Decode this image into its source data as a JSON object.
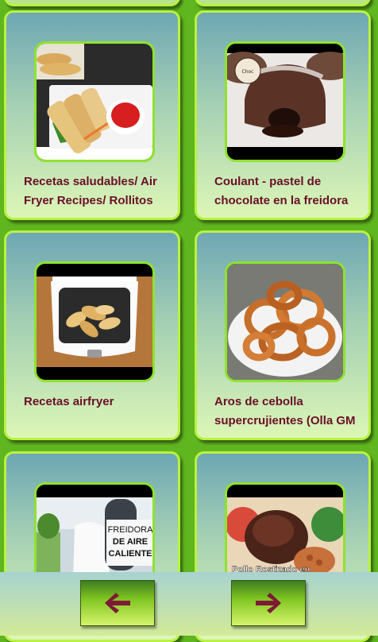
{
  "recipes": [
    {
      "title_line1": "Recetas saludables/ Air",
      "title_line2": "Fryer Recipes/ Rollitos",
      "image": "spring-rolls-photo"
    },
    {
      "title_line1": "Coulant - pastel de",
      "title_line2": "chocolate en la freidora",
      "image": "chocolate-lava-cake-photo"
    },
    {
      "title_line1": "Recetas airfryer",
      "title_line2": "",
      "image": "airfryer-potatoes-photo"
    },
    {
      "title_line1": "Aros de cebolla",
      "title_line2": "supercrujientes (Olla GM",
      "image": "onion-rings-photo"
    },
    {
      "overlay_line1": "FREIDORA",
      "overlay_line2": "DE AIRE",
      "overlay_line3": "CALIENTE",
      "image": "air-fryer-promo-photo"
    },
    {
      "overlay_text": "Pollo Rostizado en",
      "image": "roast-chicken-photo"
    }
  ],
  "nav": {
    "prev_symbol": "🡐",
    "next_symbol": "🡒"
  }
}
